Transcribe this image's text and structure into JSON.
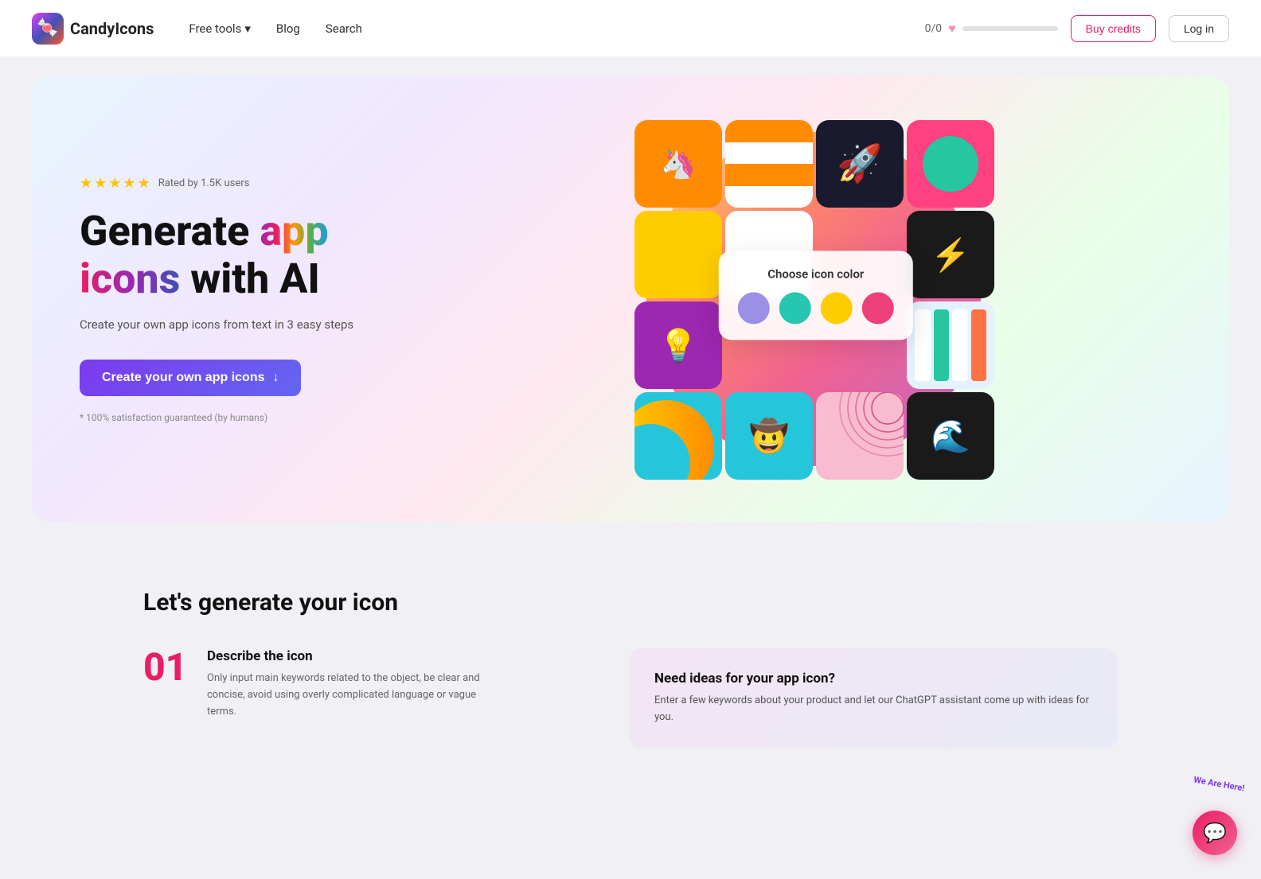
{
  "nav": {
    "logo_text": "CandyIcons",
    "logo_emoji": "🍬",
    "links": [
      {
        "id": "free-tools",
        "label": "Free tools",
        "has_dropdown": true
      },
      {
        "id": "blog",
        "label": "Blog",
        "has_dropdown": false
      },
      {
        "id": "search",
        "label": "Search",
        "has_dropdown": false
      }
    ],
    "credits_label": "0/0",
    "buy_credits_label": "Buy credits",
    "login_label": "Log in"
  },
  "hero": {
    "rating_stars": "★★★★★",
    "rating_text": "Rated by 1.5K users",
    "title_part1": "Generate ",
    "title_app": "app",
    "title_part2": "\n",
    "title_icons": "icons",
    "title_part3": " with AI",
    "subtitle": "Create your own app icons from text in 3 easy steps",
    "cta_label": "Create your own app icons",
    "guarantee": "* 100% satisfaction guaranteed (by humans)"
  },
  "color_picker": {
    "title": "Choose icon color",
    "colors": [
      "#9c8fe8",
      "#26c6b0",
      "#ffcc02",
      "#ec407a"
    ]
  },
  "section": {
    "title": "Let's generate your icon",
    "step1": {
      "number": "01",
      "heading": "Describe the icon",
      "description": "Only input main keywords related to the object, be clear and concise, avoid using overly complicated language or vague terms."
    },
    "ideas": {
      "title": "Need ideas for your app icon?",
      "description": "Enter a few keywords about your product and let our ChatGPT assistant come up with ideas for you."
    }
  },
  "grid_cells": [
    {
      "bg": "#ff8c00",
      "type": "emoji",
      "content": "🦄☕"
    },
    {
      "bg": "#ff8c00",
      "type": "stripes",
      "colors": [
        "#ff8c00",
        "#fff",
        "#ff8c00",
        "#fff"
      ]
    },
    {
      "bg": "#1a1a2e",
      "type": "emoji",
      "content": "🚀"
    },
    {
      "bg": "#ff4081",
      "type": "circle_inner",
      "inner_color": "#26c6a0"
    },
    {
      "bg": "#ffcc00",
      "type": "blocks",
      "colors": [
        "#ffcc00",
        "#fff",
        "#000",
        "#4fc3f7"
      ]
    },
    {
      "bg": "#fff",
      "type": "checker",
      "colors": [
        "#fff",
        "#e0e0e0"
      ]
    },
    {
      "bg": "#fff",
      "type": "empty"
    },
    {
      "bg": "#1a1a1a",
      "type": "lightning",
      "content": "⚡🌿"
    },
    {
      "bg": "#ff5722",
      "type": "blocks2"
    },
    {
      "bg": "#9c27b0",
      "type": "emoji",
      "content": "💡"
    },
    {
      "bg": "#fff",
      "type": "picker"
    },
    {
      "bg": "#e3f2fd",
      "type": "stripes_v"
    },
    {
      "bg": "#26c6da",
      "type": "emoji",
      "content": "🤠"
    },
    {
      "bg": "#f8bbd0",
      "type": "rings"
    },
    {
      "bg": "#1a1a1a",
      "type": "emoji",
      "content": "🌊"
    }
  ],
  "chat_badge": "We Are Here!"
}
